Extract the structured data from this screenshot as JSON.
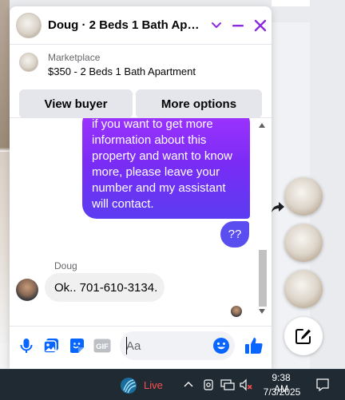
{
  "chat": {
    "title": "Doug · 2 Beds 1 Bath Apar...",
    "listing": {
      "source": "Marketplace",
      "title": "$350 - 2 Beds 1 Bath Apartment"
    },
    "buttons": {
      "view_buyer": "View buyer",
      "more_options": "More options"
    },
    "messages": {
      "outgoing_text": "if you want to get more\ninformation about this\nproperty and want to know\nmore, please leave your\nnumber and my assistant\nwill contact.",
      "outgoing_short": "??",
      "sender_name": "Doug",
      "incoming_text": "Ok.. 701-610-3134."
    },
    "composer": {
      "placeholder": "Aa",
      "gif_label": "GIF"
    },
    "colors": {
      "accent": "#7a2cf5",
      "bubble_gradient_top": "#a033ff",
      "bubble_gradient_bottom": "#5b3cf2",
      "icon_blue": "#0866ff",
      "header_purple": "#8a2be2"
    }
  },
  "taskbar": {
    "live_label": "Live",
    "time": "9:38 AM",
    "date": "7/3/2025"
  },
  "icons": [
    "chevron-down-icon",
    "minimize-icon",
    "close-icon",
    "microphone-icon",
    "photo-icon",
    "sticker-icon",
    "gif-icon",
    "emoji-icon",
    "thumbs-up-icon",
    "share-icon",
    "new-message-icon",
    "live-icon",
    "tray-chevron-icon",
    "network-icon",
    "volume-muted-icon",
    "notification-icon"
  ]
}
